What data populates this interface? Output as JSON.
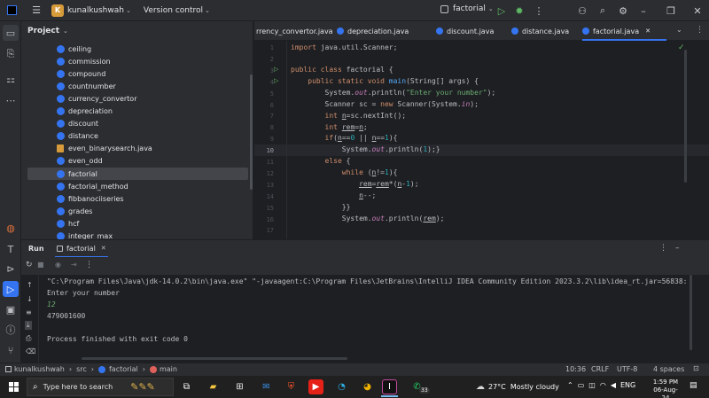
{
  "titlebar": {
    "project_initial": "K",
    "project_name": "kunalkushwah",
    "vcs": "Version control",
    "run_config": "factorial"
  },
  "project_panel": {
    "title": "Project",
    "items": [
      {
        "label": "ceiling",
        "kind": "class"
      },
      {
        "label": "commission",
        "kind": "class"
      },
      {
        "label": "compound",
        "kind": "class"
      },
      {
        "label": "countnumber",
        "kind": "class"
      },
      {
        "label": "currency_convertor",
        "kind": "class"
      },
      {
        "label": "depreciation",
        "kind": "class"
      },
      {
        "label": "discount",
        "kind": "class"
      },
      {
        "label": "distance",
        "kind": "class"
      },
      {
        "label": "even_binarysearch.java",
        "kind": "file"
      },
      {
        "label": "even_odd",
        "kind": "class"
      },
      {
        "label": "factorial",
        "kind": "class",
        "selected": true
      },
      {
        "label": "factorial_method",
        "kind": "class"
      },
      {
        "label": "fibbanociiseries",
        "kind": "class"
      },
      {
        "label": "grades",
        "kind": "class"
      },
      {
        "label": "hcf",
        "kind": "class"
      },
      {
        "label": "integer_max",
        "kind": "class"
      }
    ]
  },
  "tabs": [
    {
      "label": "rrency_convertor.java"
    },
    {
      "label": "depreciation.java"
    },
    {
      "label": "discount.java"
    },
    {
      "label": "distance.java"
    },
    {
      "label": "factorial.java",
      "active": true
    }
  ],
  "editor": {
    "line_numbers": [
      "1",
      "2",
      "3",
      "4",
      "5",
      "6",
      "7",
      "8",
      "9",
      "10",
      "11",
      "12",
      "13",
      "14",
      "15",
      "16",
      "17"
    ],
    "current_line": "10"
  },
  "run_panel": {
    "title": "Run",
    "tab_label": "factorial",
    "console": [
      "\"C:\\Program Files\\Java\\jdk-14.0.2\\bin\\java.exe\" \"-javaagent:C:\\Program Files\\JetBrains\\IntelliJ IDEA Community Edition 2023.3.2\\lib\\idea_rt.jar=56838:C:\\P",
      "Enter your number",
      "12",
      "479001600",
      "",
      "Process finished with exit code 0"
    ]
  },
  "statusbar": {
    "crumbs": [
      "kunalkushwah",
      "src",
      "factorial",
      "main"
    ],
    "position": "10:36",
    "line_sep": "CRLF",
    "encoding": "UTF-8",
    "indent": "4 spaces"
  },
  "taskbar": {
    "search_placeholder": "Type here to search",
    "weather": "27°C  Mostly cloudy",
    "lang": "ENG",
    "time": "1:59 PM",
    "date": "06-Aug-24",
    "badge": "33"
  }
}
